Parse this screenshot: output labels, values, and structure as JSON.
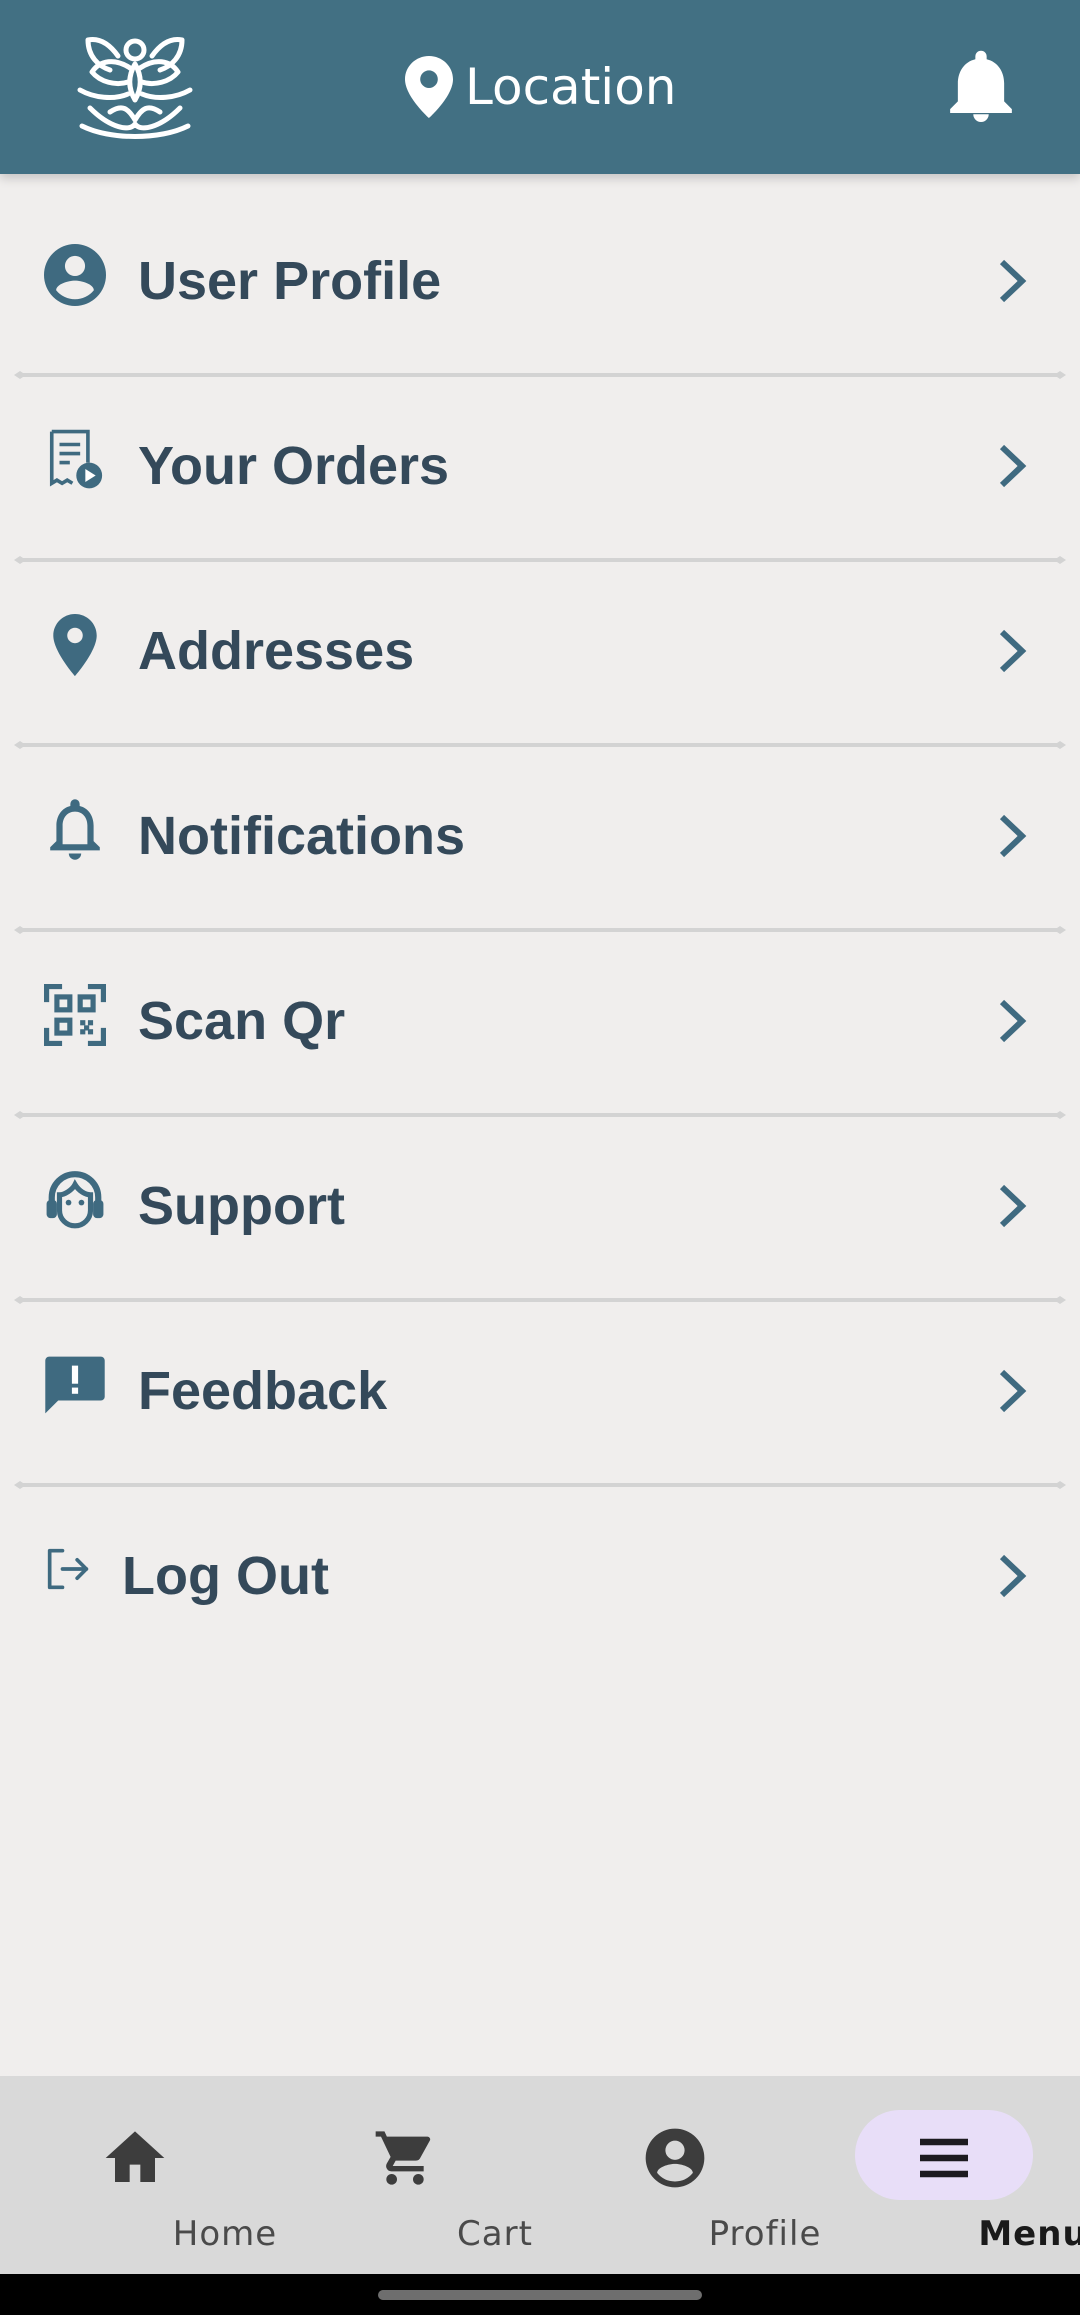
{
  "header": {
    "location_label": "Location",
    "icons": [
      "lotus-logo",
      "location-pin-icon",
      "bell-icon"
    ],
    "background": "#427083"
  },
  "menu": {
    "items": [
      {
        "label": "User Profile",
        "icon": "user-circle-icon"
      },
      {
        "label": "Your Orders",
        "icon": "orders-receipt-icon"
      },
      {
        "label": "Addresses",
        "icon": "location-pin-icon"
      },
      {
        "label": "Notifications",
        "icon": "bell-icon"
      },
      {
        "label": "Scan Qr",
        "icon": "qr-scan-icon"
      },
      {
        "label": "Support",
        "icon": "headset-icon"
      },
      {
        "label": "Feedback",
        "icon": "feedback-icon"
      },
      {
        "label": "Log Out",
        "icon": "logout-icon"
      }
    ],
    "text_color": "#34495a",
    "icon_color": "#3f6a80"
  },
  "bottom_nav": {
    "items": [
      {
        "label": "Home",
        "icon": "home-icon"
      },
      {
        "label": "Cart",
        "icon": "cart-icon"
      },
      {
        "label": "Profile",
        "icon": "account-circle-icon"
      },
      {
        "label": "Menu",
        "icon": "menu-icon",
        "active": true
      }
    ],
    "active_pill_color": "#e8def8"
  }
}
